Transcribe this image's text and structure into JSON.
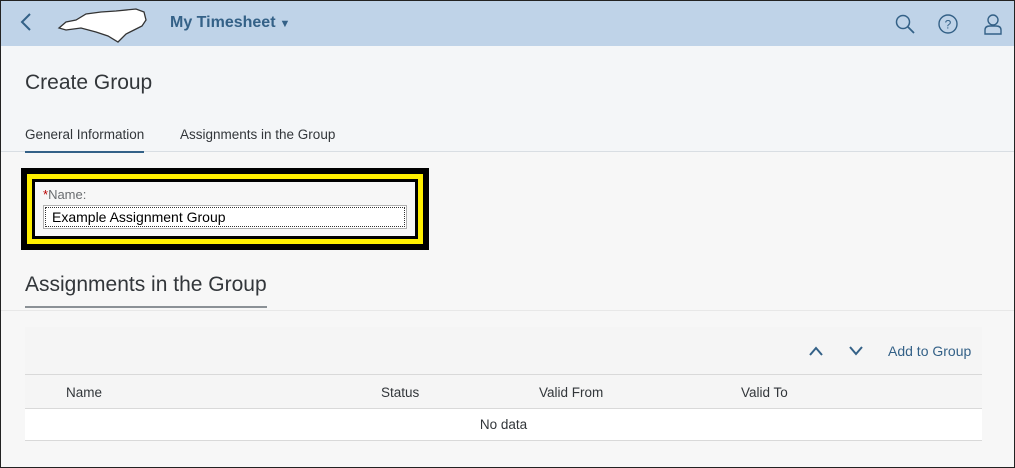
{
  "shell": {
    "title": "My Timesheet",
    "back_icon": "chevron-left-icon",
    "logo": "north-carolina-state-outline",
    "icons": [
      "search-icon",
      "help-icon",
      "user-icon"
    ]
  },
  "page": {
    "title": "Create Group",
    "tabs": [
      {
        "label": "General Information",
        "selected": true
      },
      {
        "label": "Assignments in the Group",
        "selected": false
      }
    ]
  },
  "form": {
    "required_marker": "*",
    "name_label": "Name:",
    "name_value": "Example Assignment Group"
  },
  "section": {
    "title": "Assignments in the Group"
  },
  "table": {
    "toolbar": {
      "add_label": "Add to Group"
    },
    "columns": [
      "Name",
      "Status",
      "Valid From",
      "Valid To"
    ],
    "empty_text": "No data"
  },
  "colors": {
    "shell_bg": "#bfd3e8",
    "accent": "#346187",
    "highlight": "#ffef00"
  }
}
